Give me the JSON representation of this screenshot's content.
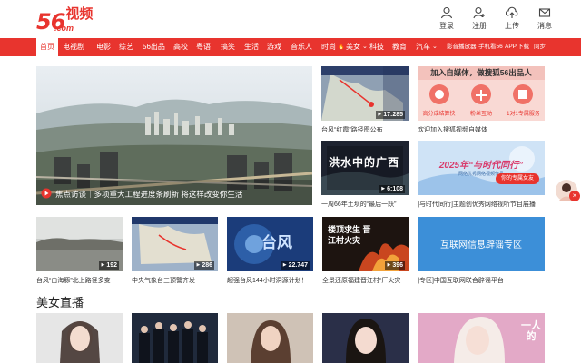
{
  "header": {
    "logo_number": "56",
    "logo_cn": "视频",
    "logo_domain": ".com",
    "actions": [
      {
        "label": "登录",
        "icon": "user-icon"
      },
      {
        "label": "注册",
        "icon": "register-icon"
      },
      {
        "label": "上传",
        "icon": "upload-icon"
      },
      {
        "label": "消息",
        "icon": "mail-icon"
      }
    ]
  },
  "nav": {
    "items": [
      "首页",
      "电视剧",
      "电影",
      "综艺",
      "56出品",
      "高校",
      "粤语",
      "搞笑",
      "生活",
      "游戏",
      "音乐人",
      "时尚",
      "美女",
      "科技",
      "教育",
      "汽车"
    ],
    "hot_badge": "🔥",
    "dropdown_glyph": "⌄",
    "right_links": [
      "影音播放器",
      "手机看56",
      "APP",
      "下载",
      "同步"
    ]
  },
  "hero": {
    "caption": "焦点访谈｜多项重大工程进度条刷新 将这样改变你生活"
  },
  "top_row": {
    "news": {
      "overlay": "",
      "duration": "17:285",
      "caption": "台风“红霞”路径图公布"
    },
    "promo": {
      "title": "加入自媒体，做搜狐56出品人",
      "features": [
        "高分成结算快",
        "粉丝互动",
        "1对1专属服务"
      ],
      "caption": "欢迎加入搜狐视频自媒体"
    }
  },
  "mid_row": [
    {
      "overlay": "洪水中的广西",
      "duration": "6:108",
      "caption": "一周66年土坝的“最后一跃”"
    },
    {
      "overlay": "2025年“与时代同行”",
      "subtitle": "网络优秀网络视频作品",
      "duration": "",
      "caption": "[与时代同行]主题创优秀网络视听节目展播",
      "chip": "你的专属女友"
    }
  ],
  "row3": [
    {
      "duration": "192",
      "caption": "台风“白海豚”北上路径多变"
    },
    {
      "duration": "286",
      "caption": "中央气象台三预警齐发"
    },
    {
      "overlay": "台风",
      "duration": "22.747",
      "caption": "超强台风144小时洞源计划！"
    },
    {
      "overlay": "楼顶求生 晋江村火灾",
      "duration": "396",
      "caption": "全景还原福建晋江村“厂火灾"
    },
    {
      "overlay": "互联网信息辟谣专区",
      "caption": "[专区]中国互联网联合辟谣平台"
    }
  ],
  "live": {
    "title": "美女直播",
    "overlay_last": "一人的"
  },
  "colors": {
    "brand_red": "#e8342e",
    "promo_pink": "#f6b7b3",
    "accent_blue": "#3c8fd8"
  }
}
